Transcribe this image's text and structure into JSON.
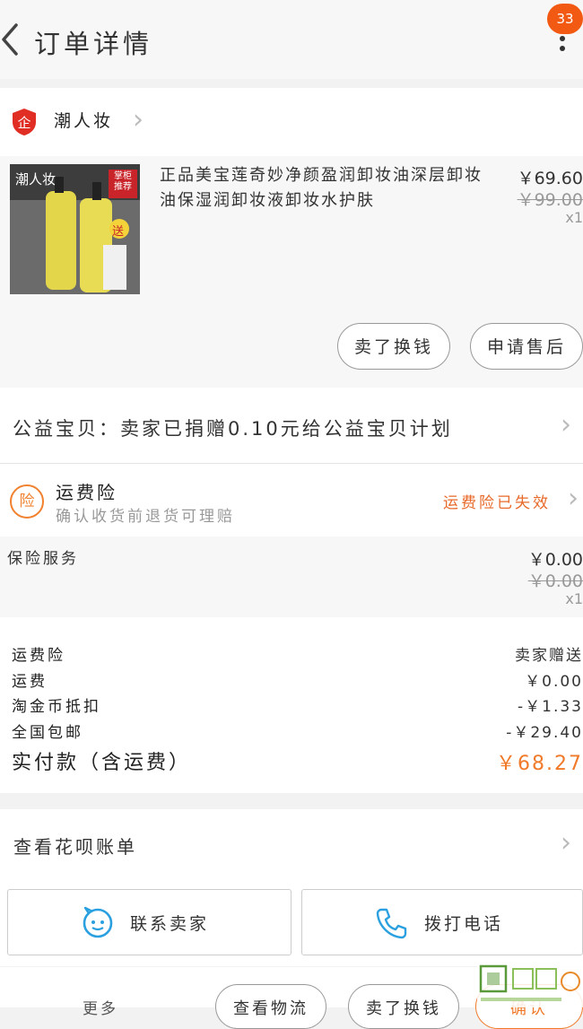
{
  "header": {
    "title": "订单详情",
    "badge_count": "33"
  },
  "shop": {
    "name": "潮人妆",
    "icon": "shop-enterprise-icon"
  },
  "product": {
    "thumb_brand": "潮人妆",
    "thumb_tag": "掌柜推荐",
    "thumb_gift": "送",
    "name": "正品美宝莲奇妙净颜盈润卸妆油深层卸妆油保湿润卸妆液卸妆水护肤",
    "price": "￥69.60",
    "original_price": "￥99.00",
    "quantity": "x1",
    "sell_button": "卖了换钱",
    "after_sale_button": "申请售后"
  },
  "charity": {
    "text": "公益宝贝：卖家已捐赠0.10元给公益宝贝计划"
  },
  "insurance": {
    "icon_char": "险",
    "title": "运费险",
    "subtitle": "确认收货前退货可理赔",
    "status": "运费险已失效"
  },
  "service": {
    "label": "保险服务",
    "price": "￥0.00",
    "original_price": "￥0.00",
    "quantity": "x1"
  },
  "fees": {
    "items": [
      {
        "label": "运费险",
        "value": "卖家赠送"
      },
      {
        "label": "运费",
        "value": "￥0.00"
      },
      {
        "label": "淘金币抵扣",
        "value": "-￥1.33"
      },
      {
        "label": "全国包邮",
        "value": "-￥29.40"
      }
    ],
    "total_label": "实付款（含运费）",
    "total_value": "￥68.27"
  },
  "bill": {
    "label": "查看花呗账单"
  },
  "actions": {
    "contact_seller": "联系卖家",
    "call_phone": "拨打电话"
  },
  "bottom_bar": {
    "more": "更多",
    "view_logistics": "查看物流",
    "sell": "卖了换钱",
    "confirm": "确认"
  },
  "colors": {
    "accent": "#f07a2a",
    "badge": "#f25a13",
    "contact_icon": "#2aa0e0"
  }
}
